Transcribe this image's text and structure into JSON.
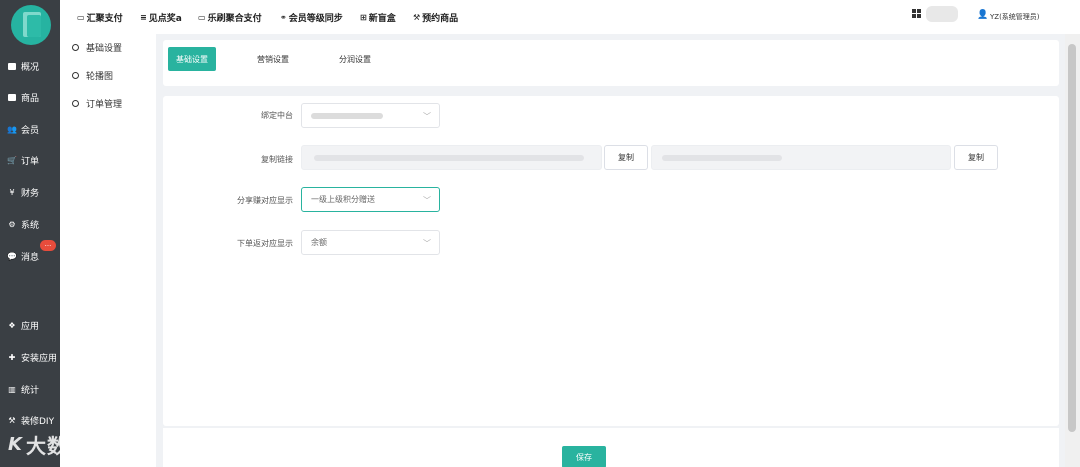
{
  "top_nav": [
    {
      "icon": "card-icon",
      "glyph": "▭",
      "label": "汇聚支付"
    },
    {
      "icon": "list-icon",
      "glyph": "≡",
      "label": "见点奖a"
    },
    {
      "icon": "card-icon",
      "glyph": "▭",
      "label": "乐刷聚合支付"
    },
    {
      "icon": "link-icon",
      "glyph": "⚭",
      "label": "会员等级同步"
    },
    {
      "icon": "plus-box-icon",
      "glyph": "⊞",
      "label": "新盲盒"
    },
    {
      "icon": "hammer-icon",
      "glyph": "⚒",
      "label": "预约商品"
    }
  ],
  "user": {
    "name": "YZ(系统管理员)",
    "icon": "user-icon"
  },
  "sidebar": [
    {
      "icon": "square-icon",
      "label": "概况"
    },
    {
      "icon": "square-icon",
      "label": "商品"
    },
    {
      "icon": "users-icon",
      "label": "会员"
    },
    {
      "icon": "cart-icon",
      "label": "订单"
    },
    {
      "icon": "yen-icon",
      "label": "财务"
    },
    {
      "icon": "gears-icon",
      "label": "系统"
    },
    {
      "icon": "chat-icon",
      "label": "消息"
    },
    {
      "icon": "cubes-icon",
      "label": "应用"
    },
    {
      "icon": "puzzle-icon",
      "label": "安装应用"
    },
    {
      "icon": "bar-chart-icon",
      "label": "统计"
    },
    {
      "icon": "hammer-icon",
      "label": "装修DIY"
    }
  ],
  "message_badge": "...",
  "submenu": [
    {
      "label": "基础设置"
    },
    {
      "label": "轮播图"
    },
    {
      "label": "订单管理"
    }
  ],
  "tabs": [
    {
      "label": "基础设置",
      "active": true
    },
    {
      "label": "营销设置",
      "active": false
    },
    {
      "label": "分润设置",
      "active": false
    }
  ],
  "form": {
    "bind_label": "绑定中台",
    "copy_link_label": "复制链接",
    "copy_button": "复制",
    "share_label": "分享赚对应显示",
    "share_value": "一级上级积分赠送",
    "order_label": "下单返对应显示",
    "order_value": "余额"
  },
  "save_button": "保存",
  "watermark": {
    "text": "大数跨境"
  },
  "colors": {
    "accent": "#29b39f",
    "sidebar": "#3a3f44",
    "badge": "#e74c3c"
  }
}
